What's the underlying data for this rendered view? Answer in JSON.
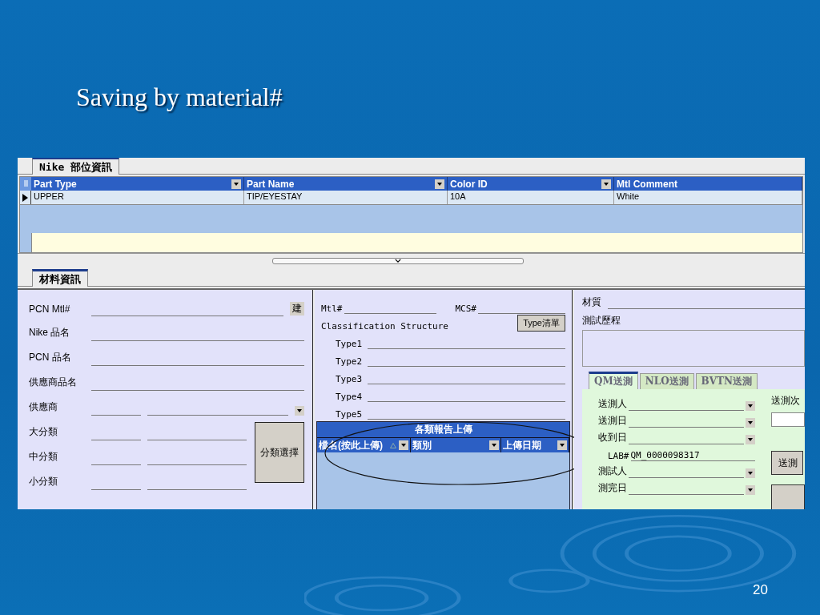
{
  "slide": {
    "title": "Saving by material#",
    "page_number": "20"
  },
  "top_tabs": [
    {
      "label": "Nike 部位資訊",
      "selected": true
    }
  ],
  "parts_grid": {
    "columns": [
      "Part Type",
      "Part Name",
      "Color ID",
      "Mtl Comment"
    ],
    "rows": [
      {
        "cells": [
          "UPPER",
          "TIP/EYESTAY",
          "10A",
          "White"
        ],
        "selected": true
      }
    ]
  },
  "material_tabs": [
    {
      "label": "材料資訊",
      "selected": true
    }
  ],
  "material_fields": [
    {
      "kind": "text",
      "label": "PCN Mtl#",
      "button": "建"
    },
    {
      "kind": "text",
      "label": "Nike 品名"
    },
    {
      "kind": "text",
      "label": "PCN 品名"
    },
    {
      "kind": "text",
      "label": "供應商品名"
    },
    {
      "kind": "combo",
      "label": "供應商"
    },
    {
      "kind": "pair",
      "label": "大分類"
    },
    {
      "kind": "pair",
      "label": "中分類"
    },
    {
      "kind": "pair",
      "label": "小分類"
    }
  ],
  "classify_button": "分類選擇",
  "classification": {
    "mtl_label": "Mtl#",
    "mcs_label": "MCS#",
    "title": "Classification Structure",
    "button": "Type清單",
    "types": [
      "Type1",
      "Type2",
      "Type3",
      "Type4",
      "Type5"
    ]
  },
  "upload_grid": {
    "title": "各類報告上傳",
    "columns": [
      "檔名(按此上傳)",
      "類別",
      "上傳日期"
    ]
  },
  "test_info": {
    "material_label": "材質",
    "history_label": "測試歷程",
    "tabs": [
      {
        "label": "QM送測",
        "selected": true
      },
      {
        "label": "NLO送測",
        "selected": false
      },
      {
        "label": "BVTN送測",
        "selected": false
      }
    ],
    "fields": [
      {
        "kind": "combo",
        "label": "送測人"
      },
      {
        "kind": "combo",
        "label": "送測日"
      },
      {
        "kind": "combo",
        "label": "收到日"
      },
      {
        "kind": "value",
        "label": "LAB#",
        "value": "QM_0000098317"
      },
      {
        "kind": "combo",
        "label": "測試人"
      },
      {
        "kind": "combo",
        "label": "測完日"
      }
    ],
    "count_label": "送測次",
    "send_button": "送測"
  }
}
